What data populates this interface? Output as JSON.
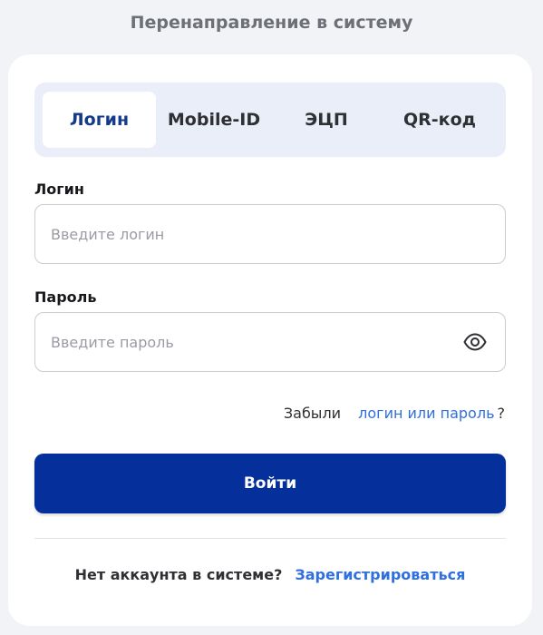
{
  "header": {
    "title": "Перенаправление в систему"
  },
  "tabs": [
    {
      "label": "Логин",
      "active": true
    },
    {
      "label": "Mobile-ID",
      "active": false
    },
    {
      "label": "ЭЦП",
      "active": false
    },
    {
      "label": "QR-код",
      "active": false
    }
  ],
  "form": {
    "login_label": "Логин",
    "login_placeholder": "Введите логин",
    "login_value": "",
    "password_label": "Пароль",
    "password_placeholder": "Введите пароль",
    "password_value": "",
    "password_toggle_icon": "eye-icon",
    "forgot_prefix": "Забыли",
    "forgot_link": "логин или пароль",
    "forgot_suffix": "?",
    "submit_label": "Войти"
  },
  "footer": {
    "no_account_text": "Нет аккаунта в системе?",
    "register_link": "Зарегистрироваться"
  },
  "colors": {
    "primary": "#05309c",
    "link": "#2f6fe0",
    "tabs_background": "#e9eef9",
    "active_tab_text": "#143a8c"
  }
}
